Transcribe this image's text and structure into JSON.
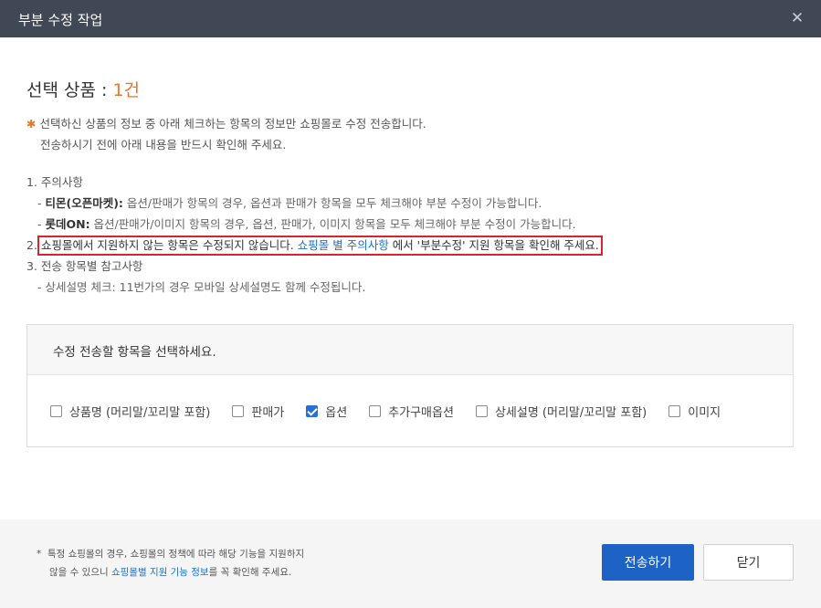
{
  "header": {
    "title": "부분 수정 작업",
    "close_glyph": "✕"
  },
  "selection": {
    "label": "선택 상품 : ",
    "count": "1건"
  },
  "intro": {
    "star": "✱",
    "line1": "선택하신 상품의 정보 중 아래 체크하는 항목의 정보만 쇼핑몰로 수정 전송합니다.",
    "line2": "전송하시기 전에 아래 내용을 반드시 확인해 주세요."
  },
  "notes": {
    "n1_title": "1. 주의사항",
    "n1_a_bold": "티몬(오픈마켓):",
    "n1_a_text": " 옵션/판매가 항목의 경우, 옵션과 판매가 항목을 모두 체크해야 부분 수정이 가능합니다.",
    "n1_b_bold": "롯데ON:",
    "n1_b_text": " 옵션/판매가/이미지 항목의 경우, 옵션, 판매가, 이미지 항목을 모두 체크해야 부분 수정이 가능합니다.",
    "n2_num": "2.",
    "n2_text1": "쇼핑몰에서 지원하지 않는 항목은 수정되지 않습니다. ",
    "n2_link": "쇼핑몰 별 주의사항",
    "n2_text2": " 에서 '부분수정' 지원 항목을 확인해 주세요.",
    "n3_title": "3. 전송 항목별 참고사항",
    "n3_a": "- 상세설명 체크: 11번가의 경우 모바일 상세설명도 함께 수정됩니다."
  },
  "panel": {
    "heading": "수정 전송할 항목을 선택하세요.",
    "options": [
      {
        "label": "상품명 (머리말/꼬리말 포함)",
        "checked": false
      },
      {
        "label": "판매가",
        "checked": false
      },
      {
        "label": "옵션",
        "checked": true
      },
      {
        "label": "추가구매옵션",
        "checked": false
      },
      {
        "label": "상세설명 (머리말/꼬리말 포함)",
        "checked": false
      },
      {
        "label": "이미지",
        "checked": false
      }
    ]
  },
  "footer": {
    "note_star": "*",
    "note_line1": "특정 쇼핑몰의 경우, 쇼핑몰의 정책에 따라 해당 기능을 지원하지",
    "note_line2_pre": "않을 수 있으니 ",
    "note_link": "쇼핑몰별 지원 기능 정보",
    "note_line2_post": "를 꼭 확인해 주세요.",
    "send_label": "전송하기",
    "close_label": "닫기"
  },
  "colors": {
    "header_bg": "#3f4854",
    "accent": "#e8762d",
    "primary": "#1d63c5",
    "link": "#1e6fc5",
    "highlight_border": "#d9232d"
  }
}
